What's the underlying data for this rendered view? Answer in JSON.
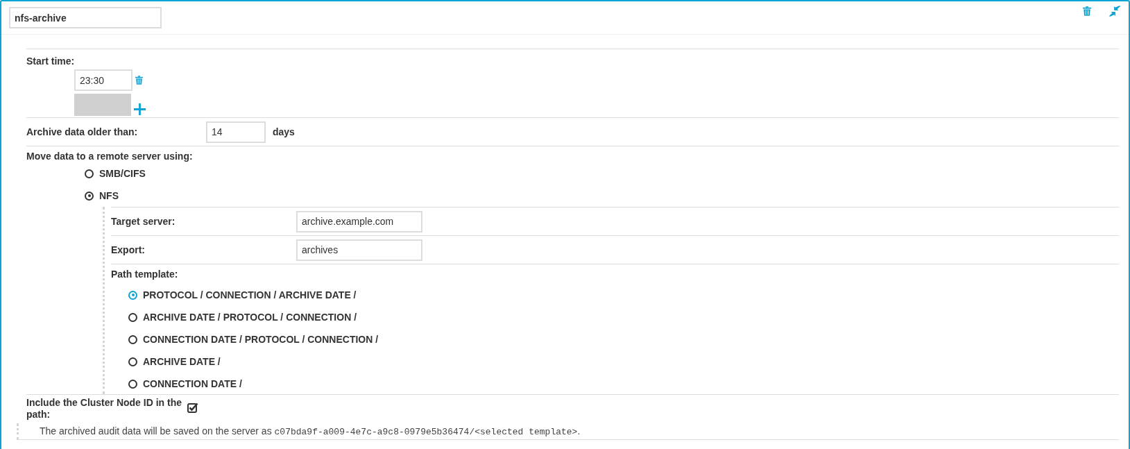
{
  "name_field": {
    "value": "nfs-archive"
  },
  "start_time": {
    "label": "Start time:",
    "times": [
      {
        "value": "23:30"
      }
    ],
    "new_time": {
      "disabled": true
    }
  },
  "archive_age": {
    "label": "Archive data older than:",
    "value": "14",
    "unit": "days"
  },
  "transport": {
    "label": "Move data to a remote server using:",
    "options": [
      {
        "label": "SMB/CIFS",
        "selected": false
      },
      {
        "label": "NFS",
        "selected": true
      }
    ]
  },
  "nfs": {
    "fields": [
      {
        "label": "Target server:",
        "value": "archive.example.com"
      },
      {
        "label": "Export:",
        "value": "archives"
      }
    ],
    "path_template": {
      "label": "Path template:",
      "options": [
        {
          "label": "PROTOCOL / CONNECTION / ARCHIVE DATE /",
          "selected": true
        },
        {
          "label": "ARCHIVE DATE / PROTOCOL / CONNECTION /",
          "selected": false
        },
        {
          "label": "CONNECTION DATE / PROTOCOL / CONNECTION /",
          "selected": false
        },
        {
          "label": "ARCHIVE DATE /",
          "selected": false
        },
        {
          "label": "CONNECTION DATE /",
          "selected": false
        }
      ]
    }
  },
  "cluster_node": {
    "label": "Include the Cluster Node ID in the path:",
    "checked": true
  },
  "note": {
    "text": "The archived audit data will be saved on the server as ",
    "code": "c07bda9f-a009-4e7c-a9c8-0979e5b36474/<selected template>",
    "end": "."
  }
}
